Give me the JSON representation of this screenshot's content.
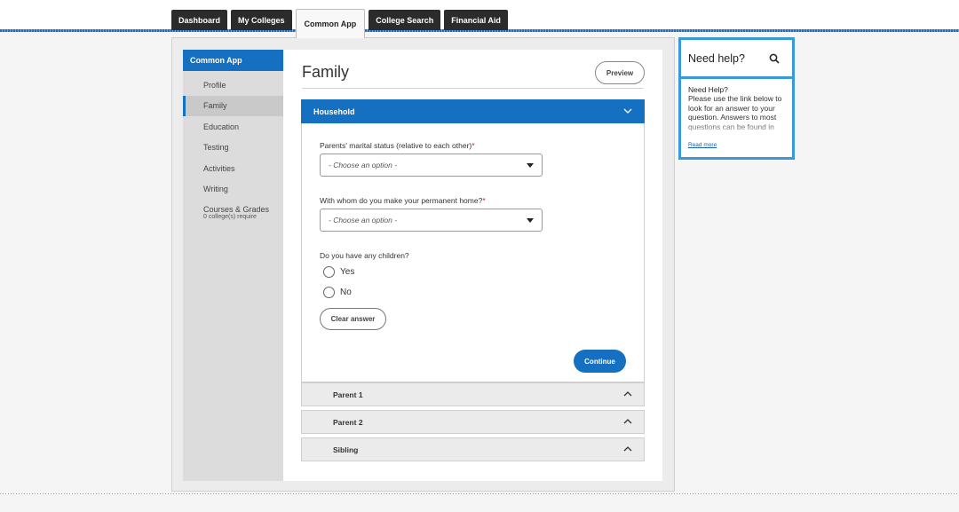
{
  "tabs": [
    "Dashboard",
    "My Colleges",
    "Common App",
    "College Search",
    "Financial Aid"
  ],
  "active_tab": "Common App",
  "sidebar": {
    "header": "Common App",
    "items": [
      {
        "label": "Profile"
      },
      {
        "label": "Family"
      },
      {
        "label": "Education"
      },
      {
        "label": "Testing"
      },
      {
        "label": "Activities"
      },
      {
        "label": "Writing"
      },
      {
        "label": "Courses & Grades",
        "sub": "0 college(s) require"
      }
    ],
    "active_item": "Family"
  },
  "main": {
    "title": "Family",
    "preview_label": "Preview",
    "household": {
      "header": "Household",
      "q1": {
        "label": "Parents' marital status (relative to each other)",
        "required_mark": "*",
        "value": "- Choose an option -"
      },
      "q2": {
        "label": "With whom do you make your permanent home?",
        "required_mark": "*",
        "value": "- Choose an option -"
      },
      "q3": {
        "label": "Do you have any children?",
        "options": [
          "Yes",
          "No"
        ]
      },
      "clear_label": "Clear answer",
      "continue_label": "Continue"
    },
    "sections": [
      "Parent 1",
      "Parent 2",
      "Sibling"
    ]
  },
  "help": {
    "title": "Need help?",
    "body_title": "Need Help?",
    "body_text": "Please use the link below to look for an answer to your question. Answers to most questions can be found in",
    "link": "Read more"
  },
  "colors": {
    "accent": "#1570c2",
    "help_border": "#3a9ad9",
    "required": "#c0272d"
  }
}
